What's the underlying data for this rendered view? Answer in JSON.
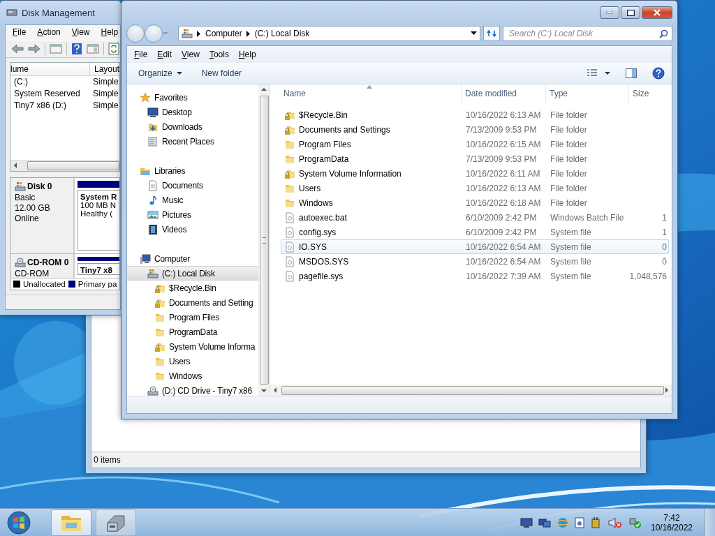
{
  "disk_management": {
    "title": "Disk Management",
    "menu": [
      "File",
      "Action",
      "View",
      "Help"
    ],
    "columns": [
      "lume",
      "Layout"
    ],
    "rows": [
      [
        "(C:)",
        "Simple"
      ],
      [
        "System Reserved",
        "Simple"
      ],
      [
        "Tiny7 x86 (D:)",
        "Simple"
      ]
    ],
    "disks": [
      {
        "name": "Disk 0",
        "kind": "disk",
        "lines": [
          "Basic",
          "12.00 GB",
          "Online"
        ],
        "partition": {
          "title": "System R",
          "lines": [
            "100 MB N",
            "Healthy ("
          ]
        }
      },
      {
        "name": "CD-ROM 0",
        "kind": "cdrom",
        "lines": [
          "CD-ROM"
        ],
        "partition": {
          "title": "Tiny7 x8"
        }
      }
    ],
    "legend": [
      {
        "label": "Unallocated",
        "color": "#000000"
      },
      {
        "label": "Primary pa",
        "color": "#000080"
      }
    ]
  },
  "background_window": {
    "status": "0 items"
  },
  "explorer": {
    "address": [
      "Computer",
      "(C:) Local Disk"
    ],
    "search": {
      "placeholder": "Search (C:) Local Disk"
    },
    "menu": [
      "File",
      "Edit",
      "View",
      "Tools",
      "Help"
    ],
    "commands": [
      {
        "label": "Organize",
        "dropdown": true
      },
      {
        "label": "New folder",
        "dropdown": false
      }
    ],
    "nav": [
      {
        "label": "Favorites",
        "kind": "star",
        "selected": false,
        "children": [
          {
            "label": "Desktop",
            "kind": "desktop",
            "selected": false
          },
          {
            "label": "Downloads",
            "kind": "downloads",
            "selected": false
          },
          {
            "label": "Recent Places",
            "kind": "recent",
            "selected": false
          }
        ]
      },
      {
        "label": "Libraries",
        "kind": "library",
        "selected": false,
        "children": [
          {
            "label": "Documents",
            "kind": "document",
            "selected": false
          },
          {
            "label": "Music",
            "kind": "music",
            "selected": false
          },
          {
            "label": "Pictures",
            "kind": "pictures",
            "selected": false
          },
          {
            "label": "Videos",
            "kind": "videos",
            "selected": false
          }
        ]
      },
      {
        "label": "Computer",
        "kind": "computer",
        "selected": false,
        "children": [
          {
            "label": "(C:) Local Disk",
            "kind": "drive",
            "selected": true,
            "children": [
              {
                "label": "$Recycle.Bin",
                "kind": "locked-folder",
                "selected": false
              },
              {
                "label": "Documents and Setting",
                "kind": "locked-folder",
                "selected": false
              },
              {
                "label": "Program Files",
                "kind": "folder",
                "selected": false
              },
              {
                "label": "ProgramData",
                "kind": "folder",
                "selected": false
              },
              {
                "label": "System Volume Informa",
                "kind": "locked-folder",
                "selected": false
              },
              {
                "label": "Users",
                "kind": "folder",
                "selected": false
              },
              {
                "label": "Windows",
                "kind": "folder",
                "selected": false
              }
            ]
          },
          {
            "label": "(D:) CD Drive - Tiny7 x86",
            "kind": "cd",
            "selected": false
          }
        ]
      }
    ],
    "columns": [
      "Name",
      "Date modified",
      "Type",
      "Size"
    ],
    "files": [
      {
        "name": "$Recycle.Bin",
        "kind": "locked-folder",
        "date": "10/16/2022 6:13 AM",
        "type": "File folder",
        "hovered": false
      },
      {
        "name": "Documents and Settings",
        "kind": "locked-folder",
        "date": "7/13/2009 9:53 PM",
        "type": "File folder",
        "hovered": false
      },
      {
        "name": "Program Files",
        "kind": "folder",
        "date": "10/16/2022 6:15 AM",
        "type": "File folder",
        "hovered": false
      },
      {
        "name": "ProgramData",
        "kind": "folder",
        "date": "7/13/2009 9:53 PM",
        "type": "File folder",
        "hovered": false
      },
      {
        "name": "System Volume Information",
        "kind": "locked-folder",
        "date": "10/16/2022 6:11 AM",
        "type": "File folder",
        "hovered": false
      },
      {
        "name": "Users",
        "kind": "folder",
        "date": "10/16/2022 6:13 AM",
        "type": "File folder",
        "hovered": false
      },
      {
        "name": "Windows",
        "kind": "folder",
        "date": "10/16/2022 6:18 AM",
        "type": "File folder",
        "hovered": false
      },
      {
        "name": "autoexec.bat",
        "kind": "file",
        "date": "6/10/2009 2:42 PM",
        "type": "Windows Batch File",
        "size": "1",
        "hovered": false
      },
      {
        "name": "config.sys",
        "kind": "file",
        "date": "6/10/2009 2:42 PM",
        "type": "System file",
        "size": "1",
        "hovered": false
      },
      {
        "name": "IO.SYS",
        "kind": "file",
        "date": "10/16/2022 6:54 AM",
        "type": "System file",
        "size": "0",
        "hovered": true
      },
      {
        "name": "MSDOS.SYS",
        "kind": "file",
        "date": "10/16/2022 6:54 AM",
        "type": "System file",
        "size": "0",
        "hovered": false
      },
      {
        "name": "pagefile.sys",
        "kind": "file",
        "date": "10/16/2022 7:39 AM",
        "type": "System file",
        "size": "1,048,576",
        "hovered": false
      }
    ]
  },
  "taskbar": {
    "buttons": [
      {
        "kind": "explorer",
        "selected": true
      },
      {
        "kind": "disk",
        "selected": false
      }
    ],
    "clock": {
      "time": "7:42",
      "date": "10/16/2022"
    }
  }
}
